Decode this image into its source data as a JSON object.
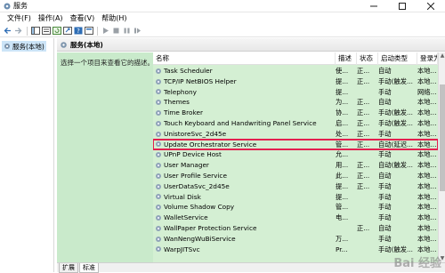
{
  "window": {
    "title": "服务"
  },
  "menu": {
    "items": [
      "文件(F)",
      "操作(A)",
      "查看(V)",
      "帮助(H)"
    ]
  },
  "tree": {
    "root_label": "服务(本地)"
  },
  "pane": {
    "header_title": "服务(本地)",
    "description_prompt": "选择一个项目来查看它的描述。"
  },
  "columns": {
    "name": "名称",
    "desc": "描述",
    "status": "状态",
    "startup": "启动类型",
    "logon": "登录为"
  },
  "services": [
    {
      "name": "Task Scheduler",
      "desc": "使...",
      "status": "正...",
      "startup": "自动",
      "logon": "本地..."
    },
    {
      "name": "TCP/IP NetBIOS Helper",
      "desc": "提...",
      "status": "正...",
      "startup": "手动(触发...",
      "logon": "本地..."
    },
    {
      "name": "Telephony",
      "desc": "提...",
      "status": "",
      "startup": "手动",
      "logon": "网络..."
    },
    {
      "name": "Themes",
      "desc": "为...",
      "status": "正...",
      "startup": "自动",
      "logon": "本地..."
    },
    {
      "name": "Time Broker",
      "desc": "协...",
      "status": "正...",
      "startup": "手动(触发...",
      "logon": "本地..."
    },
    {
      "name": "Touch Keyboard and Handwriting Panel Service",
      "desc": "启...",
      "status": "正...",
      "startup": "手动(触发...",
      "logon": "本地..."
    },
    {
      "name": "UnistoreSvc_2d45e",
      "desc": "处...",
      "status": "正...",
      "startup": "手动",
      "logon": "本地..."
    },
    {
      "name": "Update Orchestrator Service",
      "desc": "管...",
      "status": "正...",
      "startup": "自动(延迟...",
      "logon": "本地..."
    },
    {
      "name": "UPnP Device Host",
      "desc": "允...",
      "status": "",
      "startup": "手动",
      "logon": "本地..."
    },
    {
      "name": "User Manager",
      "desc": "用...",
      "status": "正...",
      "startup": "自动(触发...",
      "logon": "本地..."
    },
    {
      "name": "User Profile Service",
      "desc": "此...",
      "status": "正...",
      "startup": "自动",
      "logon": "本地..."
    },
    {
      "name": "UserDataSvc_2d45e",
      "desc": "提...",
      "status": "正...",
      "startup": "手动",
      "logon": "本地..."
    },
    {
      "name": "Virtual Disk",
      "desc": "提...",
      "status": "",
      "startup": "手动",
      "logon": "本地..."
    },
    {
      "name": "Volume Shadow Copy",
      "desc": "管...",
      "status": "",
      "startup": "手动",
      "logon": "本地..."
    },
    {
      "name": "WalletService",
      "desc": "电...",
      "status": "",
      "startup": "手动",
      "logon": "本地..."
    },
    {
      "name": "WallPaper Protection Service",
      "desc": "",
      "status": "正...",
      "startup": "自动",
      "logon": "本地..."
    },
    {
      "name": "WanNengWuBiService",
      "desc": "万...",
      "status": "",
      "startup": "手动",
      "logon": "本地..."
    },
    {
      "name": "WarpJITSvc",
      "desc": "Pr...",
      "status": "",
      "startup": "手动(触发...",
      "logon": "本地..."
    }
  ],
  "selected_index": 7,
  "tabs": {
    "extended": "扩展",
    "standard": "标准"
  },
  "watermark": "Bai 经验",
  "colors": {
    "list_bg": "#d4efd3",
    "desc_bg": "#c9eacb",
    "highlight": "#e3204f"
  }
}
